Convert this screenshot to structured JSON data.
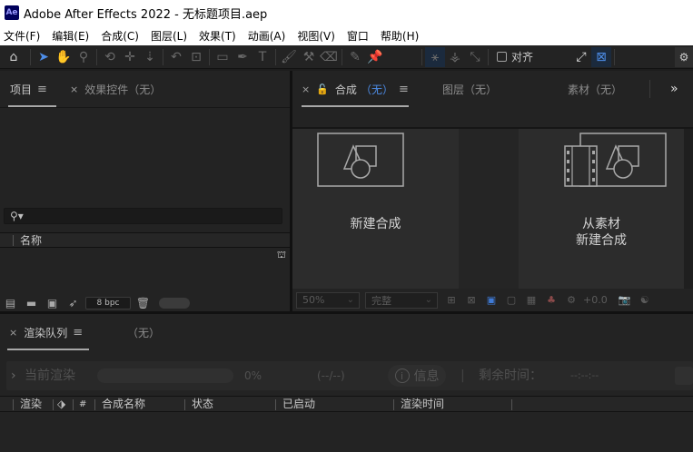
{
  "window": {
    "logo": "Ae",
    "title": "Adobe After Effects 2022 - 无标题项目.aep"
  },
  "menu": [
    "文件(F)",
    "编辑(E)",
    "合成(C)",
    "图层(L)",
    "效果(T)",
    "动画(A)",
    "视图(V)",
    "窗口",
    "帮助(H)"
  ],
  "toolbar": {
    "snap_label": "对齐"
  },
  "project_panel": {
    "tab_project": "项目",
    "tab_effects": "效果控件（无）",
    "column_name": "名称",
    "bpc": "8 bpc"
  },
  "comp_panel": {
    "tab_comp": "合成",
    "tab_comp_none": "（无）",
    "tab_layer": "图层（无）",
    "tab_footage": "素材（无）",
    "new_comp": "新建合成",
    "from_footage_line1": "从素材",
    "from_footage_line2": "新建合成",
    "zoom": "50%",
    "resolution": "完整",
    "offset": "+0.0"
  },
  "render_panel": {
    "tab_render": "渲染队列",
    "tab_none": "（无）",
    "current_render": "当前渲染",
    "percent": "0%",
    "time_placeholder": "(--/--)",
    "info": "信息",
    "remaining": "剩余时间：",
    "remaining_value": "--:--:--",
    "columns": {
      "render": "渲染",
      "tag": "",
      "num": "#",
      "comp_name": "合成名称",
      "status": "状态",
      "started": "已启动",
      "render_time": "渲染时间"
    }
  }
}
